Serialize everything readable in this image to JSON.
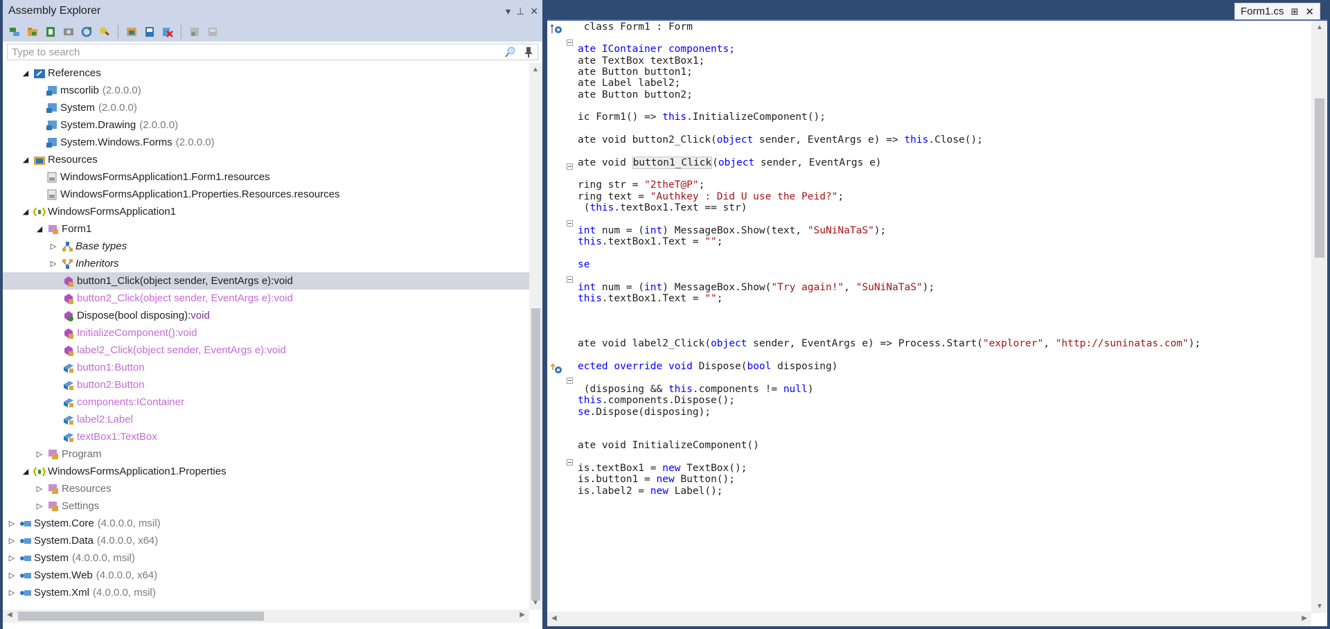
{
  "left_pane": {
    "title": "Assembly Explorer",
    "search_placeholder": "Type to search",
    "tree": [
      {
        "label": "References",
        "version": ""
      },
      {
        "label": "mscorlib",
        "version": "(2.0.0.0)"
      },
      {
        "label": "System",
        "version": "(2.0.0.0)"
      },
      {
        "label": "System.Drawing",
        "version": "(2.0.0.0)"
      },
      {
        "label": "System.Windows.Forms",
        "version": "(2.0.0.0)"
      },
      {
        "label": "Resources",
        "version": ""
      },
      {
        "label": "WindowsFormsApplication1.Form1.resources",
        "version": ""
      },
      {
        "label": "WindowsFormsApplication1.Properties.Resources.resources",
        "version": ""
      },
      {
        "label": "WindowsFormsApplication1",
        "version": ""
      },
      {
        "label": "Form1",
        "version": ""
      },
      {
        "label": "Base types",
        "version": ""
      },
      {
        "label": "Inheritors",
        "version": ""
      },
      {
        "label": "button1_Click(object sender, EventArgs e):void",
        "version": ""
      },
      {
        "label": "button2_Click(object sender, EventArgs e):void",
        "version": ""
      },
      {
        "label": "Dispose(bool disposing):",
        "version": "void"
      },
      {
        "label": "InitializeComponent():void",
        "version": ""
      },
      {
        "label": "label2_Click(object sender, EventArgs e):void",
        "version": ""
      },
      {
        "label": "button1:Button",
        "version": ""
      },
      {
        "label": "button2:Button",
        "version": ""
      },
      {
        "label": "components:IContainer",
        "version": ""
      },
      {
        "label": "label2:Label",
        "version": ""
      },
      {
        "label": "textBox1:TextBox",
        "version": ""
      },
      {
        "label": "Program",
        "version": ""
      },
      {
        "label": "WindowsFormsApplication1.Properties",
        "version": ""
      },
      {
        "label": "Resources",
        "version": ""
      },
      {
        "label": "Settings",
        "version": ""
      },
      {
        "label": "System.Core",
        "version": "(4.0.0.0, msil)"
      },
      {
        "label": "System.Data",
        "version": "(4.0.0.0, x64)"
      },
      {
        "label": "System",
        "version": "(4.0.0.0, msil)"
      },
      {
        "label": "System.Web",
        "version": "(4.0.0.0, x64)"
      },
      {
        "label": "System.Xml",
        "version": "(4.0.0.0, msil)"
      }
    ]
  },
  "right_pane": {
    "tab_title": "Form1.cs",
    "code": {
      "l0a": " class Form1 : ",
      "l0b": "Form",
      "l1a": "ate IContainer components;",
      "l2a": "ate TextBox textBox1;",
      "l3a": "ate Button button1;",
      "l4a": "ate Label label2;",
      "l5a": "ate Button button2;",
      "l6a": "ic Form1() => ",
      "l6b": "this",
      "l6c": ".InitializeComponent();",
      "l7a": "ate void button2_Click(",
      "l7b": "object",
      "l7c": " sender, EventArgs e) => ",
      "l7d": "this",
      "l7e": ".Close();",
      "l8a": "ate void ",
      "l8b": "button1_Click",
      "l8c": "(",
      "l8d": "object",
      "l8e": " sender, EventArgs e)",
      "l9a": "ring str = ",
      "l9b": "\"2theT@P\"",
      "l9c": ";",
      "l10a": "ring text = ",
      "l10b": "\"Authkey : Did U use the Peid?\"",
      "l10c": ";",
      "l11a": " (",
      "l11b": "this",
      "l11c": ".textBox1.Text == str)",
      "l12a": "int",
      "l12b": " num = (",
      "l12c": "int",
      "l12d": ") MessageBox.Show(text, ",
      "l12e": "\"SuNiNaTaS\"",
      "l12f": ");",
      "l13a": "this",
      "l13b": ".textBox1.Text = ",
      "l13c": "\"\"",
      "l13d": ";",
      "l14a": "se",
      "l15a": "int",
      "l15b": " num = (",
      "l15c": "int",
      "l15d": ") MessageBox.Show(",
      "l15e": "\"Try again!\"",
      "l15f": ", ",
      "l15g": "\"SuNiNaTaS\"",
      "l15h": ");",
      "l16a": "this",
      "l16b": ".textBox1.Text = ",
      "l16c": "\"\"",
      "l16d": ";",
      "l17a": "ate void label2_Click(",
      "l17b": "object",
      "l17c": " sender, EventArgs e) => Process.Start(",
      "l17d": "\"explorer\"",
      "l17e": ", ",
      "l17f": "\"http://suninatas.com\"",
      "l17g": ");",
      "l18a": "ected ",
      "l18b": "override",
      "l18c": " ",
      "l18d": "void",
      "l18e": " Dispose(",
      "l18f": "bool",
      "l18g": " disposing)",
      "l19a": " (disposing && ",
      "l19b": "this",
      "l19c": ".components != ",
      "l19d": "null",
      "l19e": ")",
      "l20a": "this",
      "l20b": ".components.Dispose();",
      "l21a": "se",
      "l21b": ".Dispose(disposing);",
      "l22a": "ate void InitializeComponent()",
      "l23a": "is.textBox1 = ",
      "l23b": "new",
      "l23c": " TextBox();",
      "l24a": "is.button1 = ",
      "l24b": "new",
      "l24c": " Button();",
      "l25a": "is.label2 = ",
      "l25b": "new",
      "l25c": " Label();"
    }
  },
  "colors": {
    "keyword": "#0000ff",
    "string": "#a31515",
    "member_dim": "#c56bd6",
    "selection": "#d3d6e1",
    "chrome": "#2f4a73"
  }
}
